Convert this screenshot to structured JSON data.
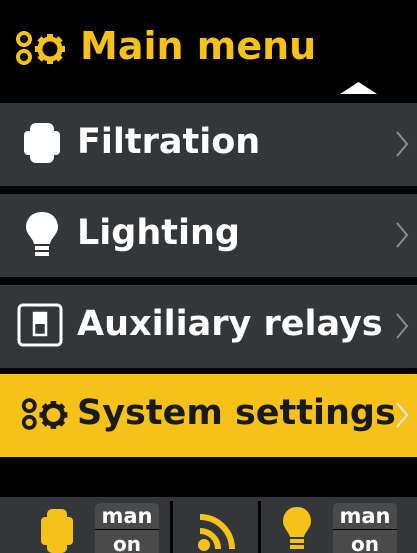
{
  "header": {
    "title": "Main menu",
    "icon": "gears-icon",
    "accent_color": "#f6c21a"
  },
  "menu": {
    "items": [
      {
        "label": "Filtration",
        "icon": "pump-icon",
        "selected": false
      },
      {
        "label": "Lighting",
        "icon": "light-bulb-icon",
        "selected": false
      },
      {
        "label": "Auxiliary relays",
        "icon": "relay-switch-icon",
        "selected": false
      },
      {
        "label": "System settings",
        "icon": "gears-icon",
        "selected": true
      }
    ]
  },
  "status_bar": {
    "filtration": {
      "icon": "pump-icon",
      "mode": "man",
      "state": "on"
    },
    "connectivity": {
      "icon": "wifi-signal-icon"
    },
    "lighting": {
      "icon": "light-bulb-icon",
      "mode": "man",
      "state": "on"
    }
  },
  "colors": {
    "background": "#000000",
    "item_background": "#34373a",
    "selected_background": "#f6c21a",
    "icon_color": "#f6c21a"
  }
}
